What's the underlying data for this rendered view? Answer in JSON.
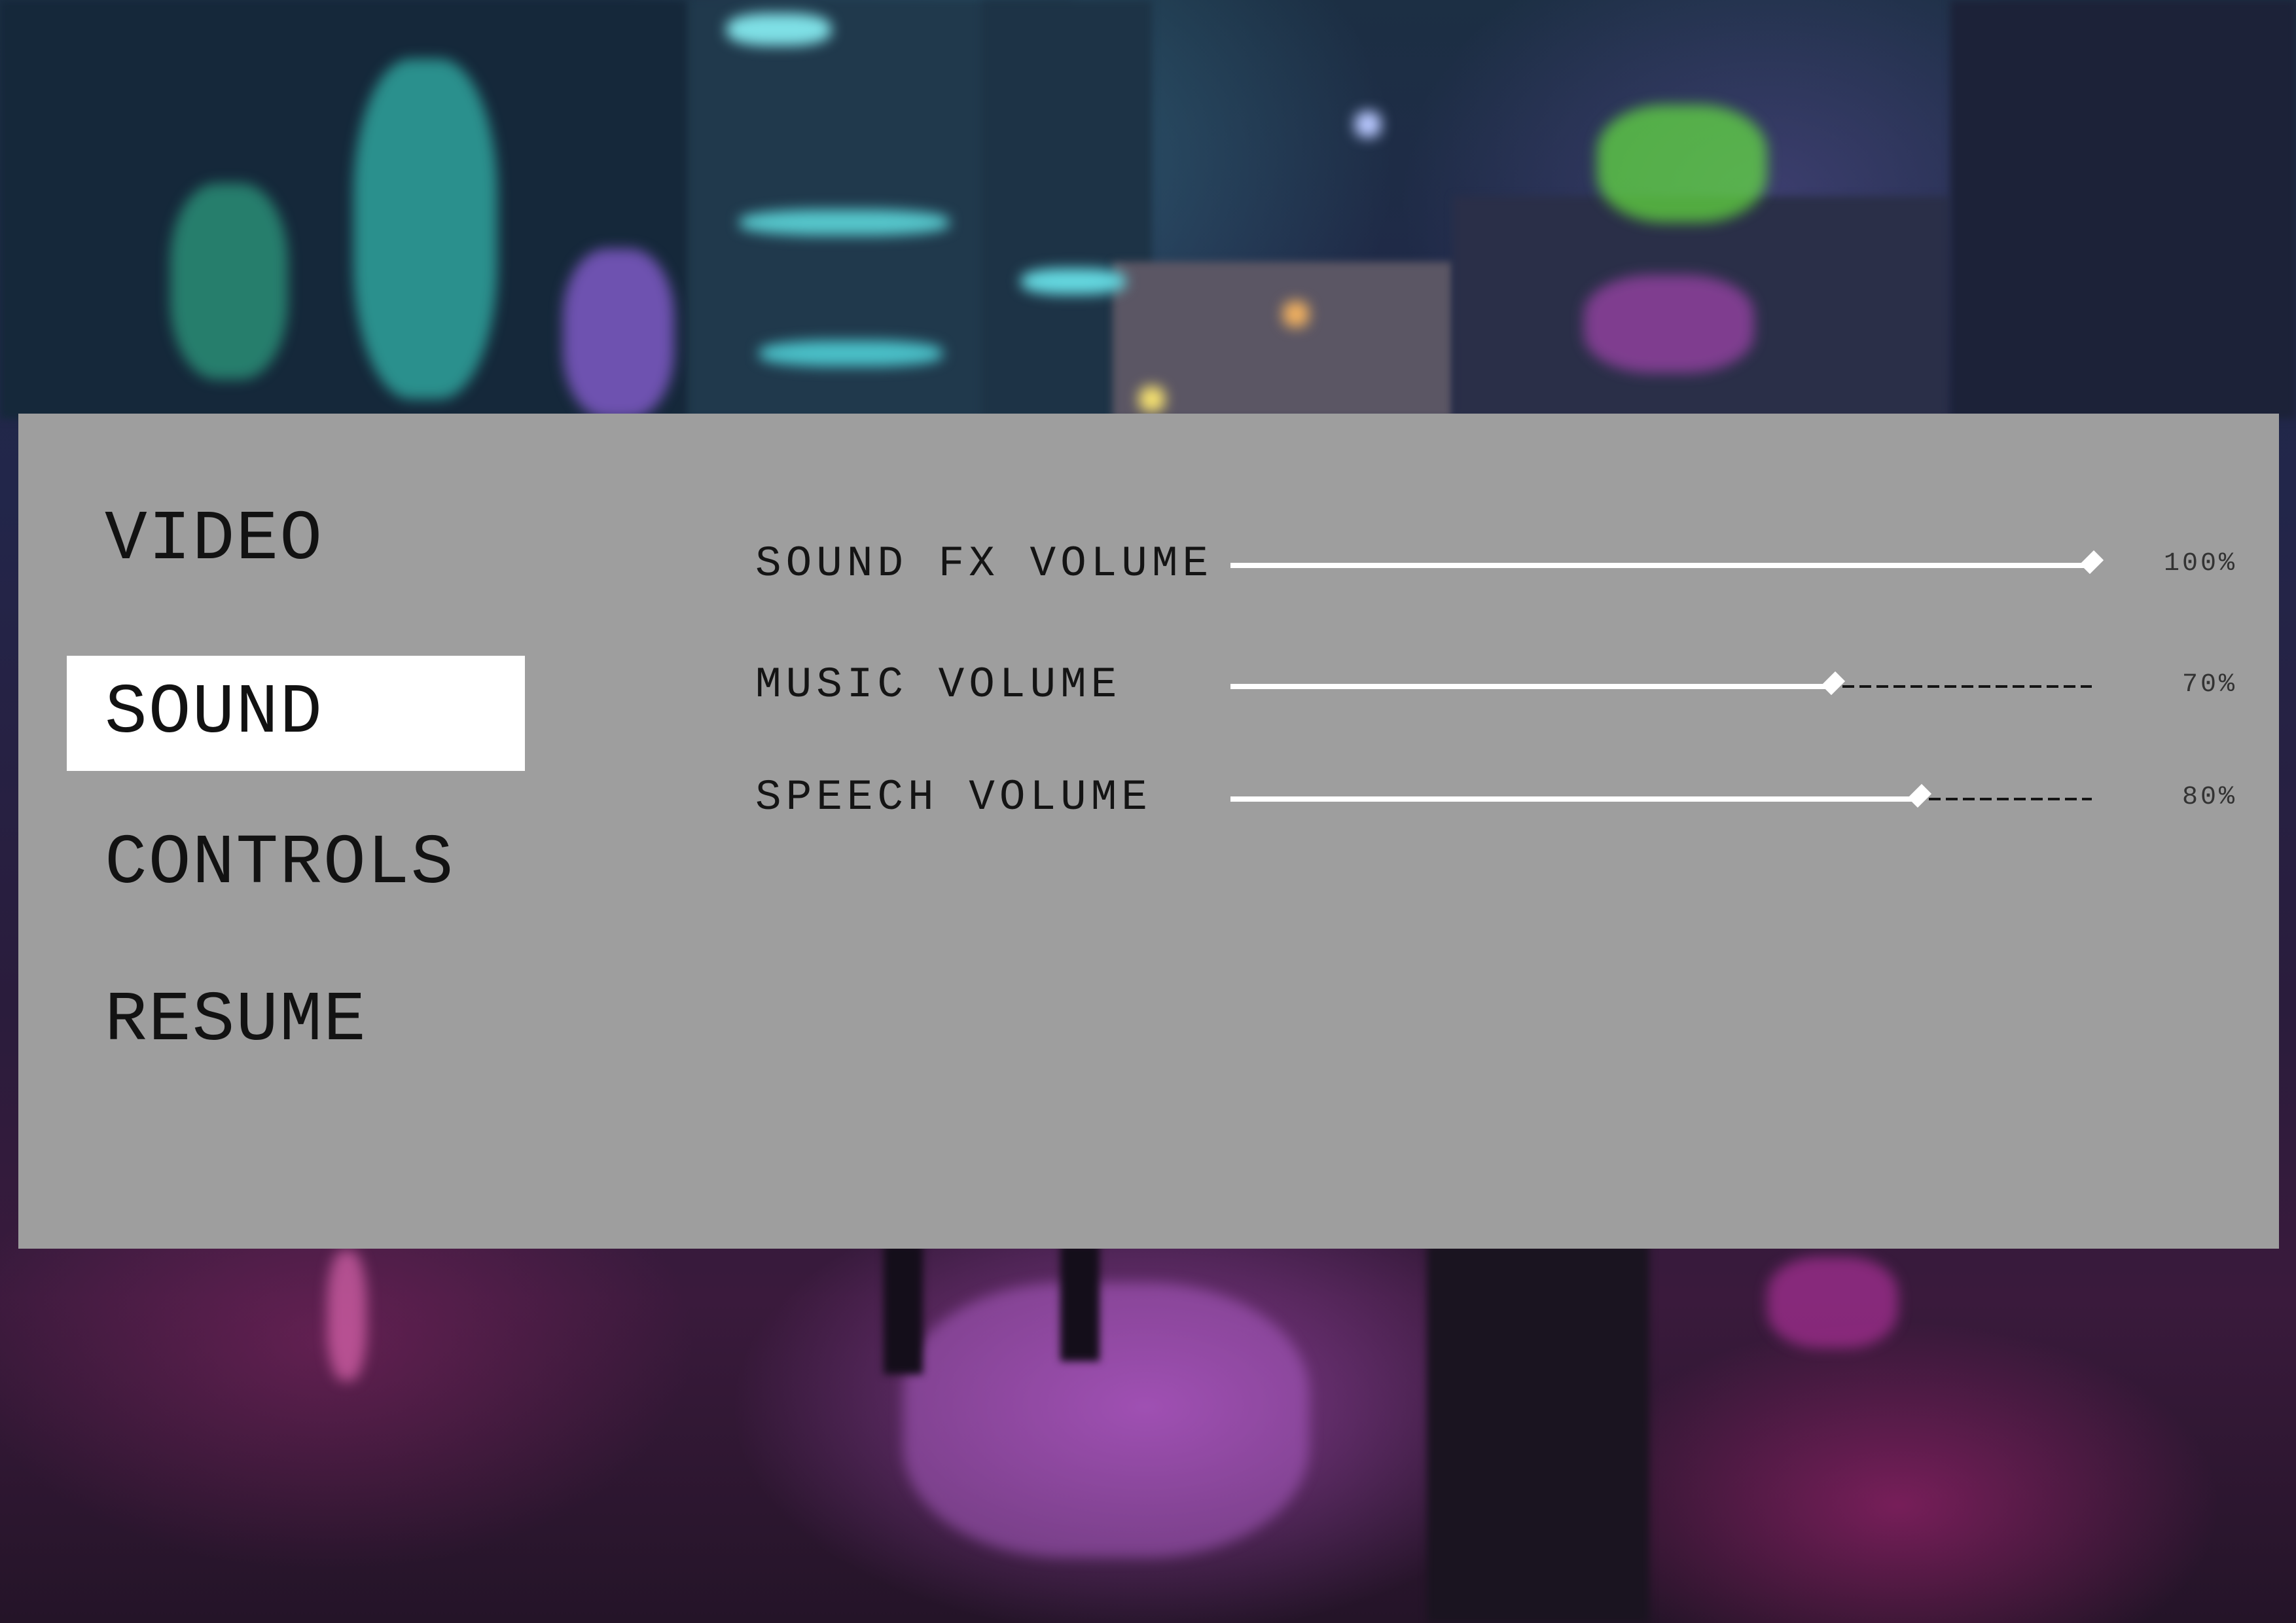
{
  "menu": {
    "items": [
      {
        "label": "VIDEO",
        "active": false
      },
      {
        "label": "SOUND",
        "active": true
      },
      {
        "label": "CONTROLS",
        "active": false
      },
      {
        "label": "RESUME",
        "active": false
      }
    ]
  },
  "sound": {
    "settings": [
      {
        "label": "SOUND FX VOLUME",
        "value": 100,
        "value_text": "100%"
      },
      {
        "label": "MUSIC VOLUME",
        "value": 70,
        "value_text": "70%"
      },
      {
        "label": "SPEECH VOLUME",
        "value": 80,
        "value_text": "80%"
      }
    ]
  },
  "colors": {
    "panel": "#9e9e9e",
    "active_tab": "#ffffff",
    "slider_fill": "#ffffff",
    "slider_rest": "#141414",
    "text": "#121212"
  },
  "icons": {
    "slider_thumb": "diamond"
  }
}
